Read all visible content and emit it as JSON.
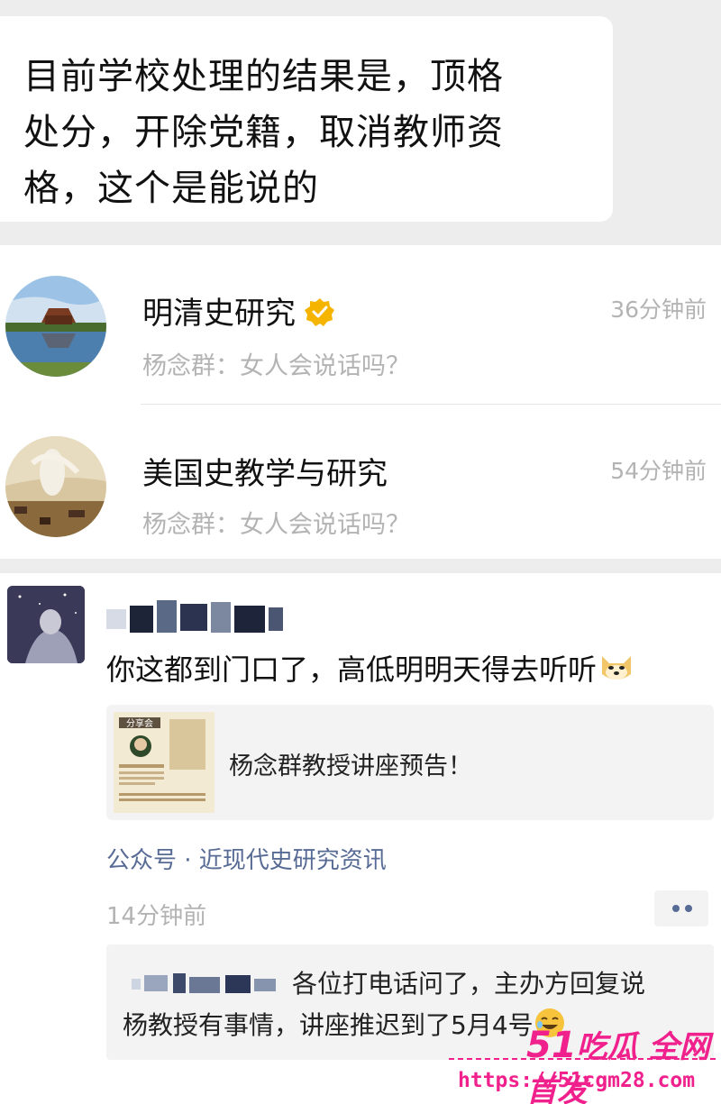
{
  "top_bubble": {
    "lines": [
      "目前学校处理的结果是，顶格",
      "处分，开除党籍，取消教师资",
      "格，这个是能说的"
    ]
  },
  "list": [
    {
      "title": "明清史研究",
      "verified": true,
      "time": "36分钟前",
      "subtitle": "杨念群：女人会说话吗？",
      "avatar": "lake-pavilion-avatar"
    },
    {
      "title": "美国史教学与研究",
      "verified": false,
      "time": "54分钟前",
      "subtitle": "杨念群：女人会说话吗？",
      "avatar": "painting-avatar"
    }
  ],
  "post": {
    "text": "你这都到门口了，高低明明天得去听听",
    "share_card": {
      "title": "杨念群教授讲座预告！",
      "thumb_caption": "分享会"
    },
    "source": "公众号 · 近现代史研究资讯",
    "time": "14分钟前",
    "comment": {
      "line1": "各位打电话问了，主办方回复说",
      "line2": "杨教授有事情，讲座推迟到了5月4号"
    }
  },
  "watermark": {
    "logo_num": "51",
    "logo_text": "吃瓜 全网首发",
    "url": "https://51cgm28.com"
  },
  "colors": {
    "link": "#576b95",
    "muted": "#b3b3b3",
    "watermark": "#f0208c",
    "verified": "#f5b400"
  }
}
